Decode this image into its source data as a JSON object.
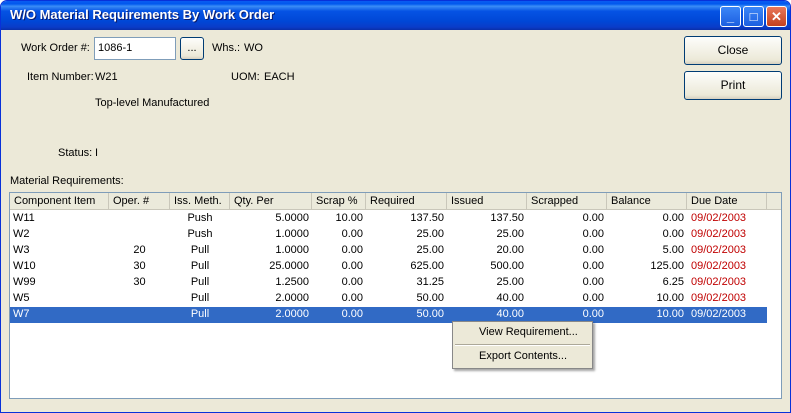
{
  "window": {
    "title": "W/O Material Requirements By Work Order",
    "minimize": "_",
    "maximize": "□",
    "close": "✕"
  },
  "form": {
    "work_order_label": "Work Order #:",
    "work_order_value": "1086-1",
    "lookup_label": "...",
    "whs_label": "Whs.:",
    "whs_value": "WO",
    "item_number_label": "Item Number:",
    "item_number_value": "W21",
    "uom_label": "UOM:",
    "uom_value": "EACH",
    "description": "Top-level Manufactured",
    "status_label": "Status:",
    "status_value": "I"
  },
  "buttons": {
    "close": "Close",
    "print": "Print"
  },
  "section_label": "Material Requirements:",
  "table": {
    "columns": [
      "Component Item",
      "Oper. #",
      "Iss. Meth.",
      "Qty. Per",
      "Scrap %",
      "Required",
      "Issued",
      "Scrapped",
      "Balance",
      "Due Date"
    ],
    "rows": [
      [
        "W11",
        "",
        "Push",
        "5.0000",
        "10.00",
        "137.50",
        "137.50",
        "0.00",
        "0.00",
        "09/02/2003"
      ],
      [
        "W2",
        "",
        "Push",
        "1.0000",
        "0.00",
        "25.00",
        "25.00",
        "0.00",
        "0.00",
        "09/02/2003"
      ],
      [
        "W3",
        "20",
        "Pull",
        "1.0000",
        "0.00",
        "25.00",
        "20.00",
        "0.00",
        "5.00",
        "09/02/2003"
      ],
      [
        "W10",
        "30",
        "Pull",
        "25.0000",
        "0.00",
        "625.00",
        "500.00",
        "0.00",
        "125.00",
        "09/02/2003"
      ],
      [
        "W99",
        "30",
        "Pull",
        "1.2500",
        "0.00",
        "31.25",
        "25.00",
        "0.00",
        "6.25",
        "09/02/2003"
      ],
      [
        "W5",
        "",
        "Pull",
        "2.0000",
        "0.00",
        "50.00",
        "40.00",
        "0.00",
        "10.00",
        "09/02/2003"
      ],
      [
        "W7",
        "",
        "Pull",
        "2.0000",
        "0.00",
        "50.00",
        "40.00",
        "0.00",
        "10.00",
        "09/02/2003"
      ]
    ],
    "selected_row": 6
  },
  "context_menu": {
    "items": [
      "View Requirement...",
      "Export Contents..."
    ]
  },
  "colors": {
    "due_date": "#c00000",
    "selection": "#316ac5",
    "titlebar": "#0047d6"
  }
}
